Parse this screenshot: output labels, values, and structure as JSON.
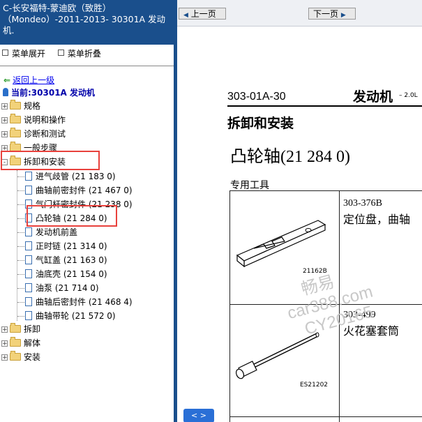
{
  "left_panel": {
    "title": "C-长安福特-蒙迪欧（致胜）（Mondeo）-2011-2013- 30301A 发动机.",
    "menu_expand": "菜单展开",
    "menu_collapse": "菜单折叠",
    "back_link": "返回上一级",
    "current": "当前:30301A 发动机",
    "tree": {
      "top": [
        {
          "label": "规格",
          "state": "+"
        },
        {
          "label": "说明和操作",
          "state": "+"
        },
        {
          "label": "诊断和测试",
          "state": "+"
        },
        {
          "label": "一般步骤",
          "state": "+"
        },
        {
          "label": "拆卸和安装",
          "state": "-"
        }
      ],
      "children": [
        "进气歧管 (21 183 0)",
        "曲轴前密封件 (21 467 0)",
        "气门杆密封件 (21 238 0)",
        "凸轮轴 (21 284 0)",
        "发动机前盖",
        "正时链 (21 314 0)",
        "气缸盖 (21 163 0)",
        "油底壳 (21 154 0)",
        "油泵 (21 714 0)",
        "曲轴后密封件 (21 468 4)",
        "曲轴带轮 (21 572 0)"
      ],
      "bottom": [
        {
          "label": "拆卸",
          "state": "+"
        },
        {
          "label": "解体",
          "state": "+"
        },
        {
          "label": "安装",
          "state": "+"
        }
      ]
    }
  },
  "right_panel": {
    "prev_page": "上一页",
    "next_page": "下一页",
    "doc_number": "303-01A-30",
    "doc_name": "发动机",
    "doc_suffix": "– 2.0L",
    "section": "拆卸和安装",
    "procedure": "凸轮轴(21 284 0)",
    "special_tools_label": "专用工具",
    "tools": [
      {
        "code": "303-376B",
        "name": "定位盘，曲轴",
        "image_id": "21162B"
      },
      {
        "code": "303-499",
        "name": "火花塞套筒",
        "image_id": "ES21202"
      }
    ],
    "watermark": [
      "畅易",
      "car388.com",
      "CY20165"
    ],
    "toggle_button": "< >"
  },
  "colors": {
    "title_bar": "#1a4f8c",
    "highlight_box": "#e8413c",
    "link": "#0000ee",
    "toggle": "#2a6fd6"
  }
}
